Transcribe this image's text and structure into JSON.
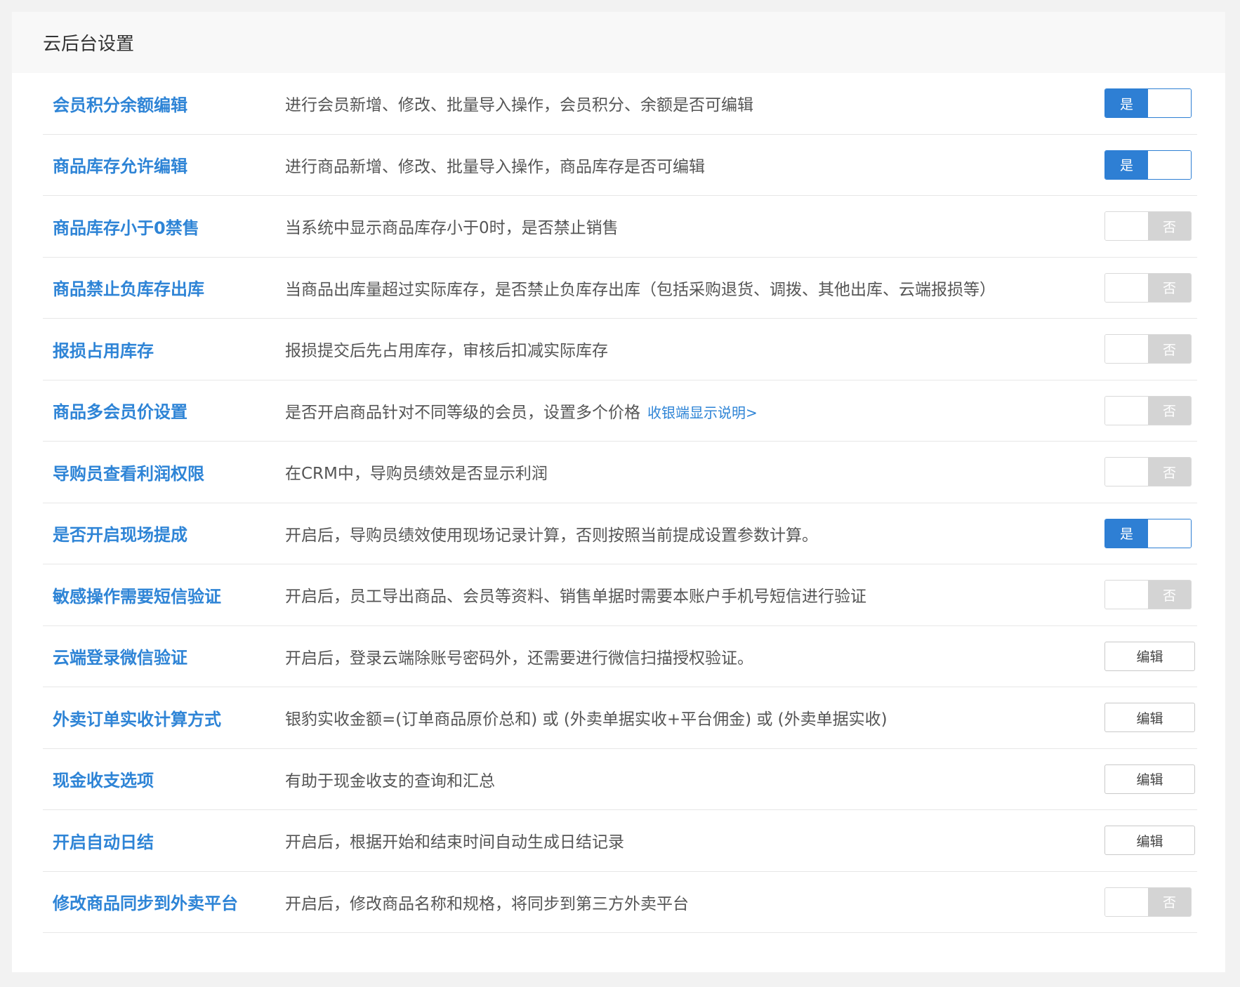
{
  "header": {
    "title": "云后台设置"
  },
  "colors": {
    "accent": "#2e84d6",
    "toggle_on": "#2e7fd4",
    "toggle_off": "#d4d4d4"
  },
  "settings": [
    {
      "title": "会员积分余额编辑",
      "desc": "进行会员新增、修改、批量导入操作，会员积分、余额是否可编辑",
      "control": "toggle",
      "state": "on",
      "label": "是"
    },
    {
      "title": "商品库存允许编辑",
      "desc": "进行商品新增、修改、批量导入操作，商品库存是否可编辑",
      "control": "toggle",
      "state": "on",
      "label": "是"
    },
    {
      "title": "商品库存小于0禁售",
      "desc": "当系统中显示商品库存小于0时，是否禁止销售",
      "control": "toggle",
      "state": "off",
      "label": "否"
    },
    {
      "title": "商品禁止负库存出库",
      "desc": "当商品出库量超过实际库存，是否禁止负库存出库（包括采购退货、调拨、其他出库、云端报损等）",
      "control": "toggle",
      "state": "off",
      "label": "否"
    },
    {
      "title": "报损占用库存",
      "desc": "报损提交后先占用库存，审核后扣减实际库存",
      "control": "toggle",
      "state": "off",
      "label": "否"
    },
    {
      "title": "商品多会员价设置",
      "desc": "是否开启商品针对不同等级的会员，设置多个价格",
      "link": "收银端显示说明>",
      "control": "toggle",
      "state": "off",
      "label": "否"
    },
    {
      "title": "导购员查看利润权限",
      "desc": "在CRM中，导购员绩效是否显示利润",
      "control": "toggle",
      "state": "off",
      "label": "否"
    },
    {
      "title": "是否开启现场提成",
      "desc": "开启后，导购员绩效使用现场记录计算，否则按照当前提成设置参数计算。",
      "control": "toggle",
      "state": "on",
      "label": "是"
    },
    {
      "title": "敏感操作需要短信验证",
      "desc": "开启后，员工导出商品、会员等资料、销售单据时需要本账户手机号短信进行验证",
      "control": "toggle",
      "state": "off",
      "label": "否"
    },
    {
      "title": "云端登录微信验证",
      "desc": "开启后，登录云端除账号密码外，还需要进行微信扫描授权验证。",
      "control": "button",
      "label": "编辑"
    },
    {
      "title": "外卖订单实收计算方式",
      "desc": "银豹实收金额=(订单商品原价总和) 或 (外卖单据实收+平台佣金) 或 (外卖单据实收)",
      "control": "button",
      "label": "编辑"
    },
    {
      "title": "现金收支选项",
      "desc": "有助于现金收支的查询和汇总",
      "control": "button",
      "label": "编辑"
    },
    {
      "title": "开启自动日结",
      "desc": "开启后，根据开始和结束时间自动生成日结记录",
      "control": "button",
      "label": "编辑"
    },
    {
      "title": "修改商品同步到外卖平台",
      "desc": "开启后，修改商品名称和规格，将同步到第三方外卖平台",
      "control": "toggle",
      "state": "off",
      "label": "否"
    }
  ]
}
